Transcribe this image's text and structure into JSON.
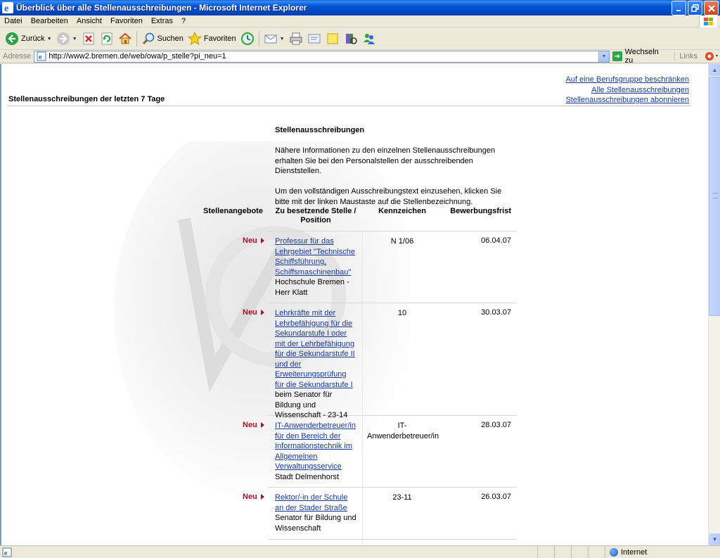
{
  "window": {
    "title": "Überblick über alle Stellenausschreibungen - Microsoft Internet Explorer"
  },
  "menu": {
    "items": [
      "Datei",
      "Bearbeiten",
      "Ansicht",
      "Favoriten",
      "Extras",
      "?"
    ]
  },
  "toolbar": {
    "back_label": "Zurück",
    "search_label": "Suchen",
    "favorites_label": "Favoriten"
  },
  "addressbar": {
    "label": "Adresse",
    "url": "http://www2.bremen.de/web/owa/p_stelle?pi_neu=1",
    "go_label": "Wechseln zu",
    "links_label": "Links"
  },
  "page": {
    "title": "Stellenausschreibungen der letzten 7 Tage",
    "links": [
      "Auf eine Berufsgruppe beschränken",
      "Alle Stellenausschreibungen",
      "Stellenausschreibungen abonnieren"
    ],
    "section_title": "Stellenausschreibungen",
    "intro_1": "Nähere Informationen zu den einzelnen Stellenausschreibungen erhalten Sie bei den Personalstellen der ausschreibenden Dienststellen.",
    "intro_2": "Um den vollständigen Ausschreibungstext einzusehen, klicken Sie bitte mit der linken Maustaste auf die Stellenbezeichnung.",
    "table": {
      "headers": {
        "stellenangebote": "Stellenangebote",
        "position": "Zu besetzende Stelle / Position",
        "kennzeichen": "Kennzeichen",
        "frist": "Bewerbungsfrist"
      },
      "rows": [
        {
          "badge": "Neu",
          "link": "Professur für das Lehrgebiet \"Technische Schiffsführung, Schiffsmaschinenbau\"",
          "employer": "Hochschule Bremen - Herr Klatt",
          "kennzeichen": "N 1/06",
          "frist": "06.04.07"
        },
        {
          "badge": "Neu",
          "link": "Lehrkräfte mit der Lehrbefähigung für die Sekundarstufe I oder mit der Lehrbefähigung für die Sekundarstufe II und der Erweiterungsprüfung für die Sekundarstufe I",
          "employer": "beim Senator für Bildung und Wissenschaft - 23-14",
          "kennzeichen": "10",
          "frist": "30.03.07"
        },
        {
          "badge": "Neu",
          "link": "IT-Anwenderbetreuer/in für den Bereich der Informationstechnik im Allgemeinen Verwaltungsservice",
          "employer": "Stadt Delmenhorst",
          "kennzeichen": "IT-Anwenderbetreuer/in",
          "frist": "28.03.07"
        },
        {
          "badge": "Neu",
          "link": "Rektor/-in der Schule an der Stader Straße",
          "employer": "Senator für Bildung und Wissenschaft",
          "kennzeichen": "23-11",
          "frist": "26.03.07"
        }
      ]
    }
  },
  "statusbar": {
    "zone": "Internet"
  }
}
